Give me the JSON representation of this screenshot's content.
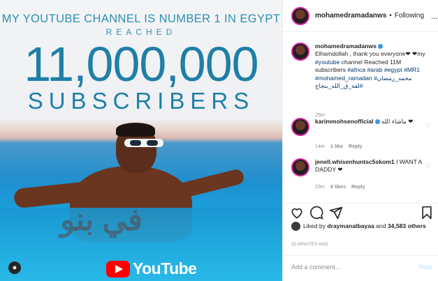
{
  "photo": {
    "headline": "MY YOUTUBE CHANNEL IS NUMBER 1 IN EGYPT",
    "reached": "REACHED",
    "count": "11,000,000",
    "subscribers": "SUBSCRIBERS",
    "watermark": "في بنو",
    "youtube": "YouTube"
  },
  "header": {
    "username": "mohamedramadanws",
    "dot": "•",
    "follow": "Following",
    "more": "..."
  },
  "caption": {
    "username": "mohamedramadanws",
    "text": "Elhamdollah , thank you everyone❤ ❤my ",
    "tag1": "#youtube",
    "text2": " channel Reached 11M subscribers ",
    "tags": "#africa #arab #egypt #MR1 #mohamed_ramadan #محمد_رمضان #لقة_ق_الله_بنجاح",
    "time": "25m"
  },
  "comments": [
    {
      "username": "karimmohsenofficial",
      "text": "ماشاء الله ❤",
      "time": "14m",
      "likes": "1 like",
      "reply": "Reply"
    },
    {
      "username": "jenell.whisenhuntsc5skom1",
      "text": "I WANT A DADDY ❤",
      "time": "23m",
      "likes": "6 likes",
      "reply": "Reply"
    }
  ],
  "likes": {
    "prefix": "Liked by ",
    "user": "draymanalbayaa",
    "middle": " and ",
    "count": "34,583 others"
  },
  "posted_ago": "25 MINUTES AGO",
  "comment_box": {
    "placeholder": "Add a comment...",
    "post": "Post"
  },
  "colors": {
    "accent": "#3897f0",
    "brand_ring": "#d6249f",
    "youtube_red": "#ff0000"
  }
}
